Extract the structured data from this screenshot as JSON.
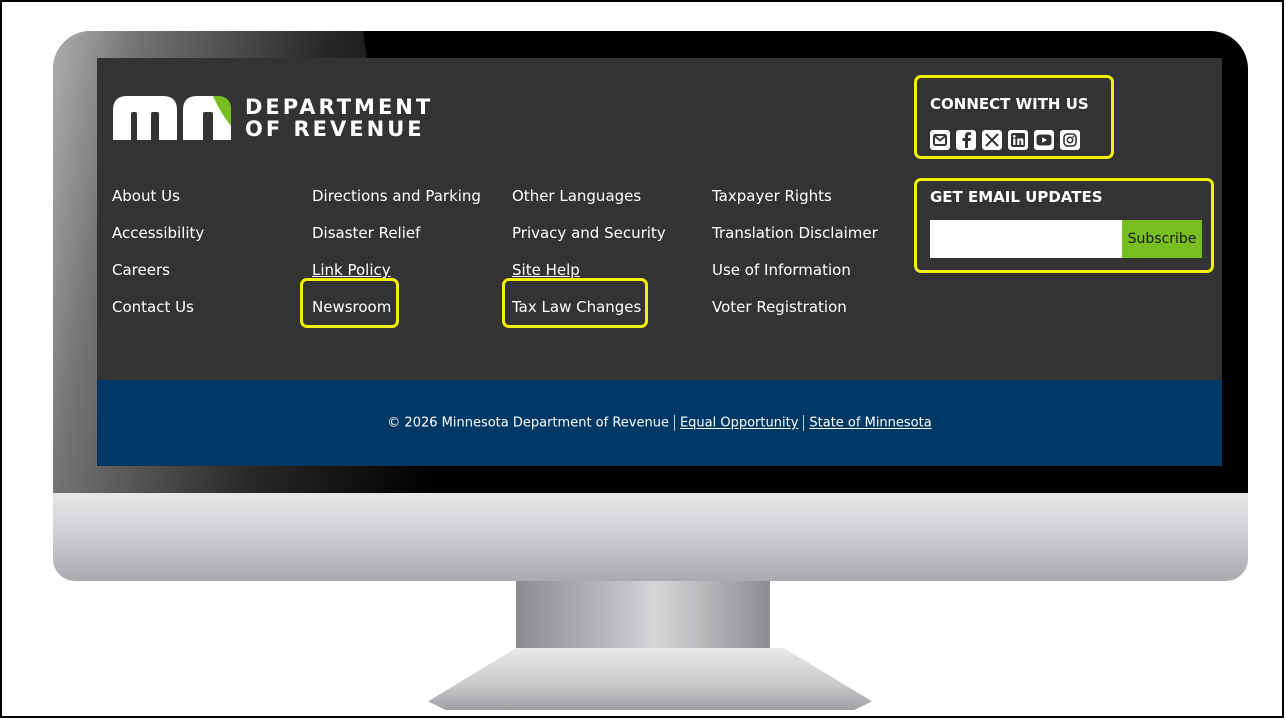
{
  "logo": {
    "line1": "DEPARTMENT",
    "line2": "OF REVENUE",
    "brand_colors": {
      "white": "#ffffff",
      "green": "#78be20"
    }
  },
  "nav": {
    "col1": [
      "About Us",
      "Accessibility",
      "Careers",
      "Contact Us"
    ],
    "col2": [
      "Directions and Parking",
      "Disaster Relief",
      "Link Policy",
      "Newsroom"
    ],
    "col3": [
      "Other Languages",
      "Privacy and Security",
      "Site Help",
      "Tax Law Changes"
    ],
    "col4": [
      "Taxpayer Rights",
      "Translation Disclaimer",
      "Use of Information",
      "Voter Registration"
    ]
  },
  "connect": {
    "title": "CONNECT WITH US",
    "icons": [
      "email-icon",
      "facebook-icon",
      "x-icon",
      "linkedin-icon",
      "youtube-icon",
      "instagram-icon"
    ]
  },
  "email_updates": {
    "title": "GET EMAIL UPDATES",
    "input_value": "",
    "button_label": "Subscribe"
  },
  "footer": {
    "copyright": "© 2026 Minnesota Department of Revenue",
    "link1": "Equal Opportunity",
    "link2": "State of Minnesota"
  },
  "colors": {
    "screen_bg": "#333333",
    "footer_bg": "#003865",
    "highlight": "#f2f200",
    "subscribe_bg": "#78be20"
  }
}
